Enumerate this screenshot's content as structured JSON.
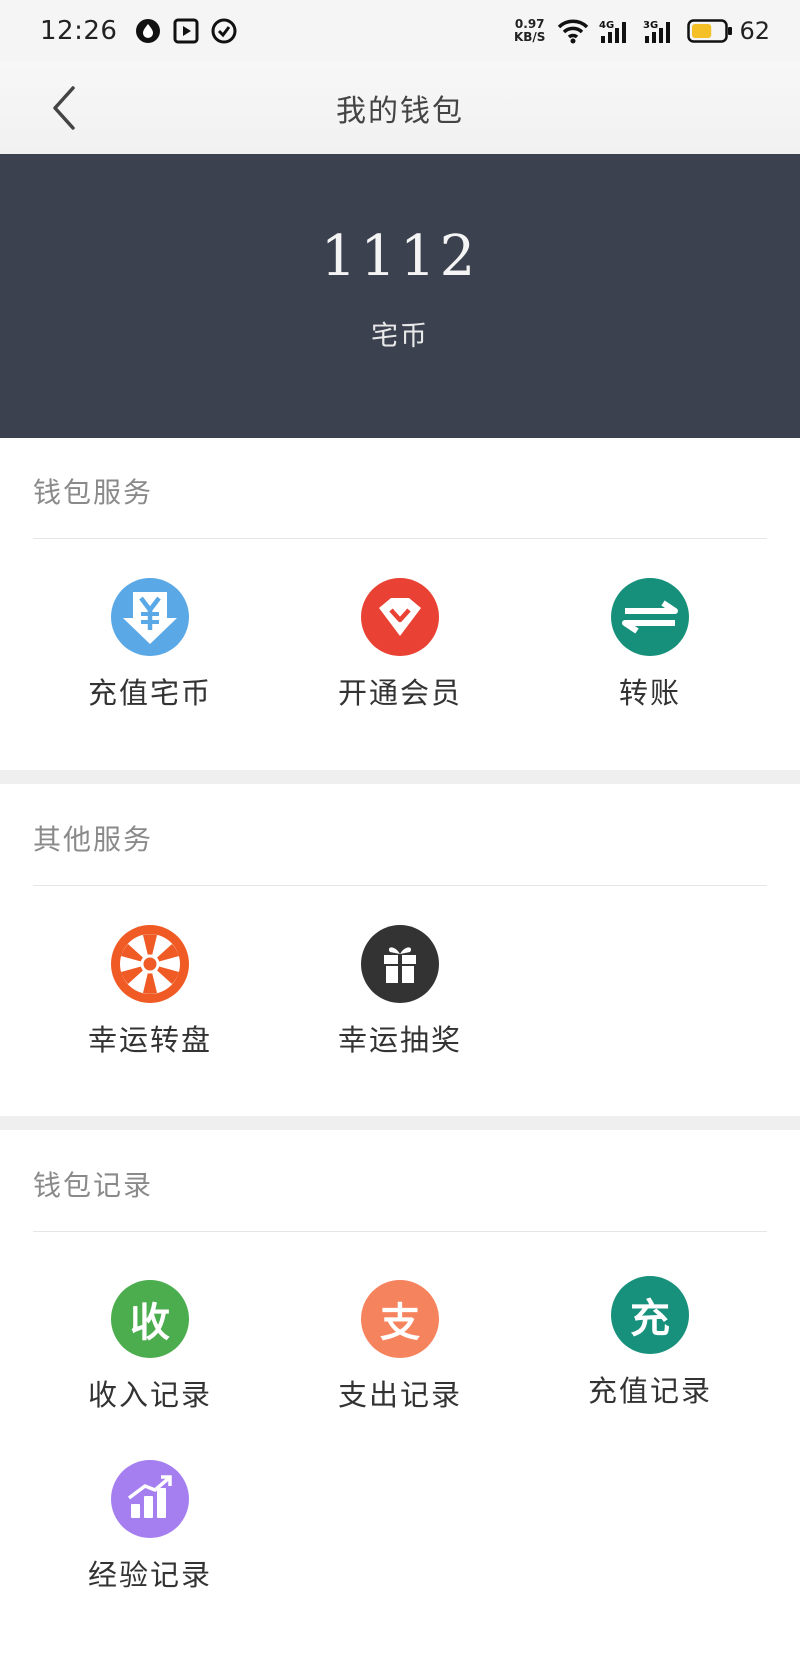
{
  "status_bar": {
    "time": "12:26",
    "net_speed_value": "0.97",
    "net_speed_unit": "KB/S",
    "signal1_label": "4G",
    "signal2_label": "3G",
    "battery_level": "62",
    "battery_color": "#f5c026"
  },
  "nav": {
    "title": "我的钱包"
  },
  "balance": {
    "amount": "1112",
    "unit": "宅币"
  },
  "sections": {
    "wallet_services": {
      "title": "钱包服务",
      "items": [
        {
          "label": "充值宅币",
          "icon": "yen-download-icon",
          "color": "#5aa9e6"
        },
        {
          "label": "开通会员",
          "icon": "vip-diamond-icon",
          "color": "#e94234"
        },
        {
          "label": "转账",
          "icon": "transfer-arrows-icon",
          "color": "#16907a"
        }
      ]
    },
    "other_services": {
      "title": "其他服务",
      "items": [
        {
          "label": "幸运转盘",
          "icon": "lucky-wheel-icon",
          "color": "#f05a24"
        },
        {
          "label": "幸运抽奖",
          "icon": "gift-icon",
          "color": "#333333"
        }
      ]
    },
    "wallet_records": {
      "title": "钱包记录",
      "items": [
        {
          "label": "收入记录",
          "icon_char": "收",
          "icon": "income-icon",
          "color": "#4cad4f"
        },
        {
          "label": "支出记录",
          "icon_char": "支",
          "icon": "expense-icon",
          "color": "#f5835e"
        },
        {
          "label": "充值记录",
          "icon_char": "充",
          "icon": "recharge-record-icon",
          "color": "#17917c"
        },
        {
          "label": "经验记录",
          "icon": "experience-chart-icon",
          "color": "#a57ff0"
        }
      ]
    }
  }
}
